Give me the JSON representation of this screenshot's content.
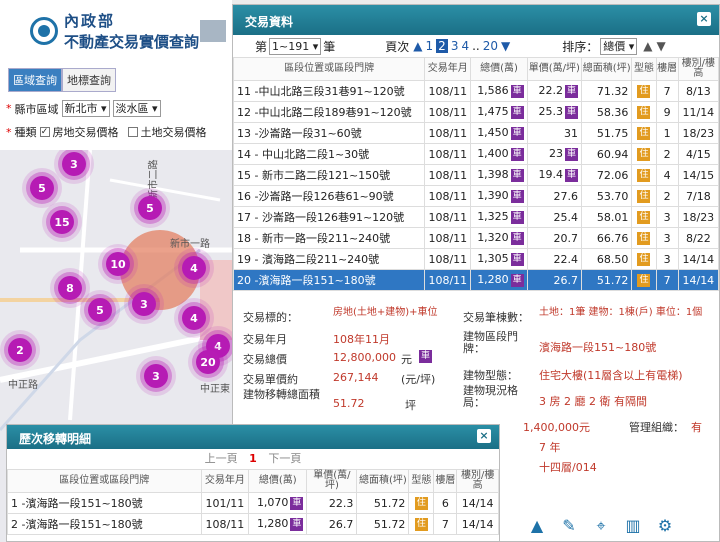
{
  "app": {
    "logo_line1": "內政部",
    "logo_line2": "不動產交易實價查詢"
  },
  "search": {
    "tab_area": "區域查詢",
    "tab_landmark": "地標查詢",
    "county_label": "縣市區域",
    "county_value": "新北市",
    "district_value": "淡水區",
    "type_label": "種類",
    "opt_house": "房地交易價格",
    "opt_land": "土地交易價格"
  },
  "map": {
    "clusters": [
      "3",
      "5",
      "5",
      "15",
      "10",
      "8",
      "4",
      "4",
      "4",
      "5",
      "3",
      "2",
      "3",
      "20",
      "3"
    ],
    "roads": [
      "新市二路",
      "中正路",
      "中正東",
      "新市一路"
    ]
  },
  "transactions": {
    "title": "交易資料",
    "close": "×",
    "page_prefix": "第",
    "page_select": "1~191",
    "page_suffix": "筆",
    "pages_label": "頁次",
    "pages": [
      "1",
      "2",
      "3",
      "4",
      "..",
      "20"
    ],
    "current_page": "2",
    "sort_label": "排序：",
    "sort_value": "總價",
    "headers": {
      "location": "區段位置或區段門牌",
      "date": "交易年月",
      "total": "總價(萬)",
      "unit": "單價(萬/坪)",
      "area": "總面積(坪)",
      "type": "型態",
      "floor": "樓層",
      "floors": "樓別/樓高"
    },
    "rows": [
      {
        "no": "11",
        "loc": "-中山北路三段31巷91~120號",
        "date": "108/11",
        "total": "1,586",
        "car": "車",
        "unit": "22.2",
        "car2": "車",
        "area": "71.32",
        "type": "住",
        "floor": "7",
        "floors": "8/13"
      },
      {
        "no": "12",
        "loc": "-中山北路二段189巷91~120號",
        "date": "108/11",
        "total": "1,475",
        "car": "車",
        "unit": "25.3",
        "car2": "車",
        "area": "58.36",
        "type": "住",
        "floor": "9",
        "floors": "11/14"
      },
      {
        "no": "13",
        "loc": "-沙崙路一段31~60號",
        "date": "108/11",
        "total": "1,450",
        "car": "車",
        "unit": "31",
        "car2": "",
        "area": "51.75",
        "type": "住",
        "floor": "1",
        "floors": "18/23"
      },
      {
        "no": "14",
        "loc": "- 中山北路二段1~30號",
        "date": "108/11",
        "total": "1,400",
        "car": "車",
        "unit": "23",
        "car2": "車",
        "area": "60.94",
        "type": "住",
        "floor": "2",
        "floors": "4/15"
      },
      {
        "no": "15",
        "loc": "- 新市二路二段121~150號",
        "date": "108/11",
        "total": "1,398",
        "car": "車",
        "unit": "19.4",
        "car2": "車",
        "area": "72.06",
        "type": "住",
        "floor": "4",
        "floors": "14/15"
      },
      {
        "no": "16",
        "loc": "-沙崙路一段126巷61~90號",
        "date": "108/11",
        "total": "1,390",
        "car": "車",
        "unit": "27.6",
        "car2": "",
        "area": "53.70",
        "type": "住",
        "floor": "2",
        "floors": "7/18"
      },
      {
        "no": "17",
        "loc": "- 沙崙路一段126巷91~120號",
        "date": "108/11",
        "total": "1,325",
        "car": "車",
        "unit": "25.4",
        "car2": "",
        "area": "58.01",
        "type": "住",
        "floor": "3",
        "floors": "18/23"
      },
      {
        "no": "18",
        "loc": "- 新市一路一段211~240號",
        "date": "108/11",
        "total": "1,320",
        "car": "車",
        "unit": "20.7",
        "car2": "",
        "area": "66.76",
        "type": "住",
        "floor": "3",
        "floors": "8/22"
      },
      {
        "no": "19",
        "loc": "- 濱海路二段211~240號",
        "date": "108/11",
        "total": "1,305",
        "car": "車",
        "unit": "22.4",
        "car2": "",
        "area": "68.50",
        "type": "住",
        "floor": "3",
        "floors": "14/14"
      },
      {
        "no": "20",
        "loc": "-濱海路一段151~180號",
        "date": "108/11",
        "total": "1,280",
        "car": "車",
        "unit": "26.7",
        "car2": "",
        "area": "51.72",
        "type": "住",
        "floor": "7",
        "floors": "14/14"
      }
    ],
    "detail": {
      "target_label": "交易標的：",
      "target_value": "房地(土地+建物)+車位",
      "date_label": "交易年月",
      "date_value": "108年11月",
      "total_label": "交易總價",
      "total_value": "12,800,000",
      "total_unit": "元",
      "unit_label": "交易單價約",
      "unit_value": "267,144",
      "unit_unit": "(元/坪)",
      "area_label": "建物移轉總面積",
      "area_value": "51.72",
      "area_unit": "坪",
      "count_label": "交易筆棟數：",
      "count_value": "土地：1筆 建物：1棟(戶) 車位：1個",
      "addr_label": "建物區段門牌：",
      "addr_value": "濱海路一段151~180號",
      "btype_label": "建物型態：",
      "btype_value": "住宅大樓(11層含以上有電梯)",
      "layout_label": "建物現況格局：",
      "layout_value": "3 房 2 廳 2 衛 有隔間",
      "price_value": "1,400,000元",
      "mgmt_label": "管理組織：",
      "mgmt_value": "有",
      "age_value": "7 年",
      "floor_value": "十四層/014"
    }
  },
  "history": {
    "title": "歷次移轉明細",
    "close": "×",
    "prev": "上一頁",
    "current": "1",
    "next": "下一頁",
    "rows": [
      {
        "no": "1",
        "loc": "-濱海路一段151~180號",
        "date": "101/11",
        "total": "1,070",
        "car": "車",
        "unit": "22.3",
        "area": "51.72",
        "type": "住",
        "floor": "6",
        "floors": "14/14"
      },
      {
        "no": "2",
        "loc": "-濱海路一段151~180號",
        "date": "108/11",
        "total": "1,280",
        "car": "車",
        "unit": "26.7",
        "area": "51.72",
        "type": "住",
        "floor": "7",
        "floors": "14/14"
      }
    ]
  }
}
